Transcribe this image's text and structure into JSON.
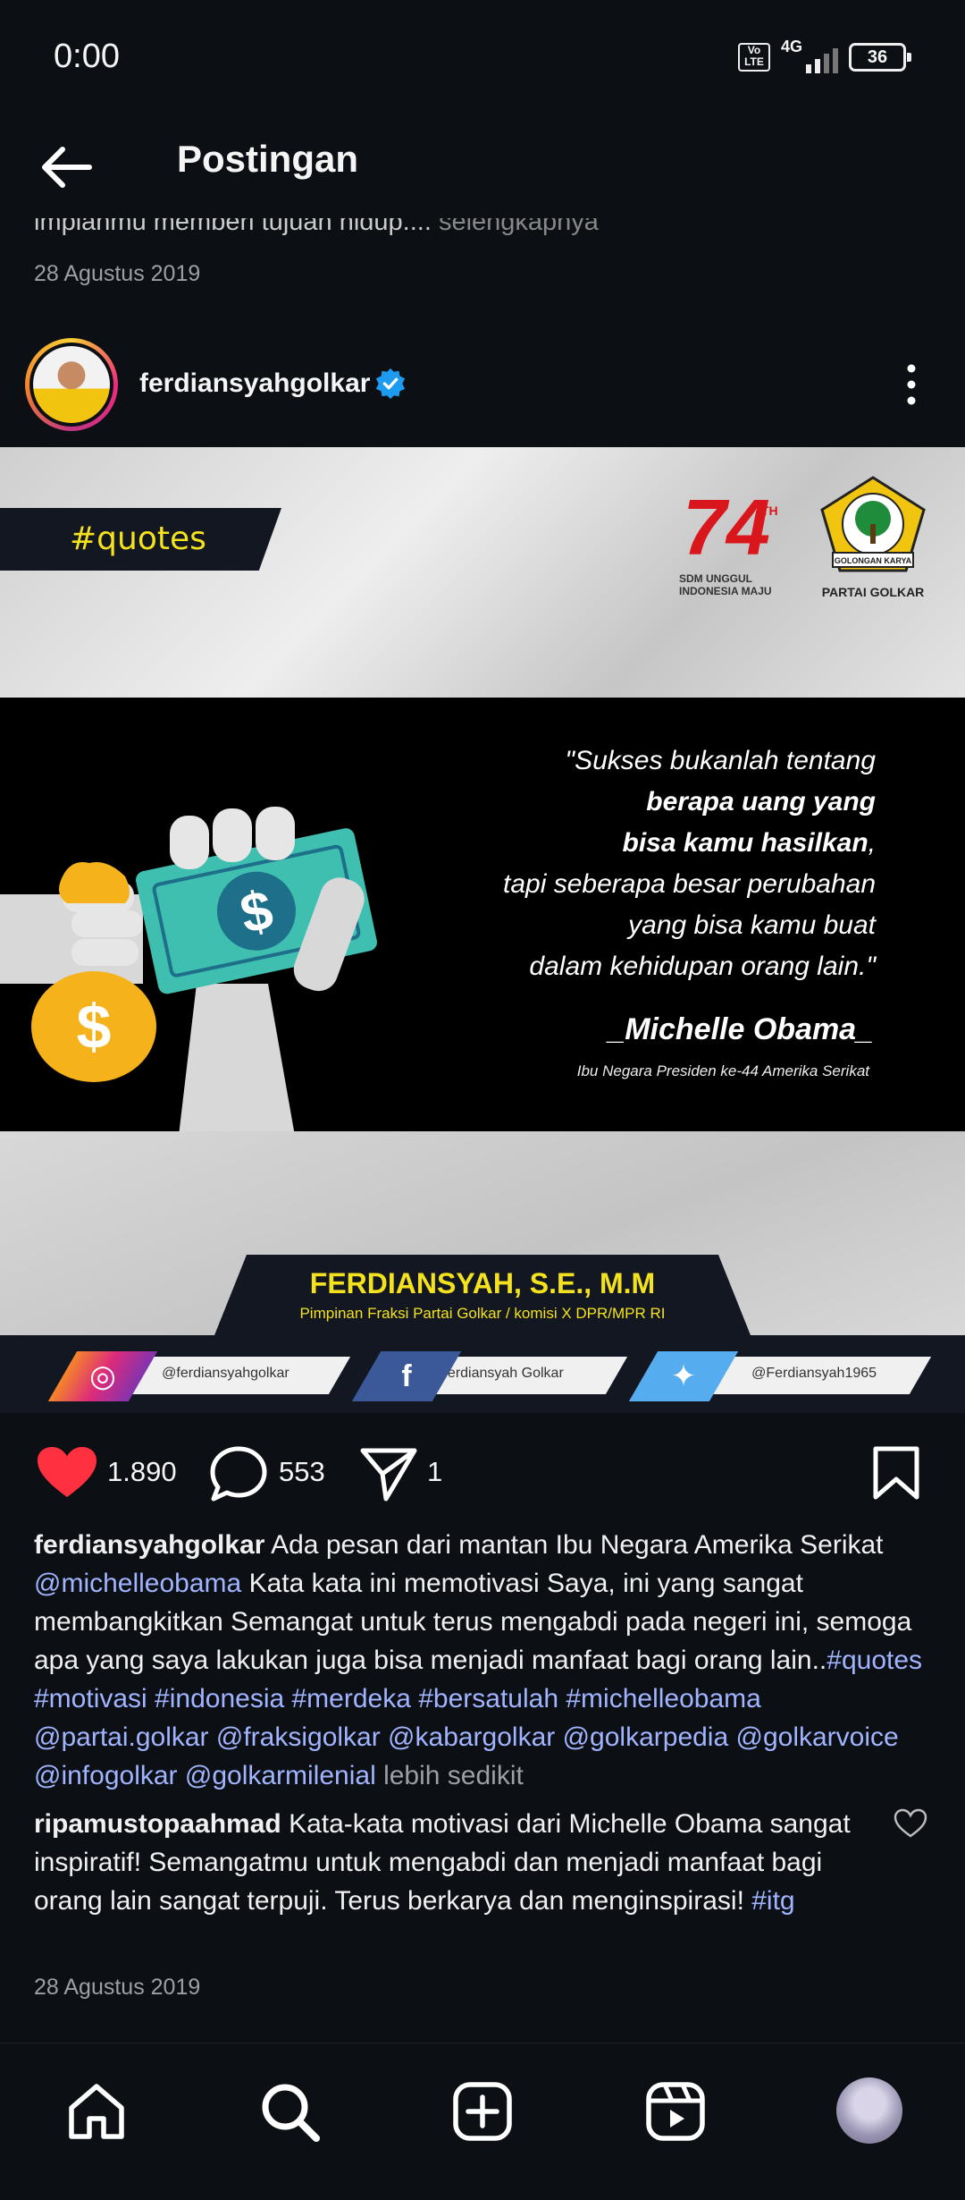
{
  "status_bar": {
    "time": "0:00",
    "volte": "Vo LTE",
    "network": "4G",
    "battery": "36"
  },
  "header": {
    "title": "Postingan",
    "back_icon": "arrow-left-icon"
  },
  "previous_post": {
    "caption_fragment": "impianmu memberi tujuan hidup....",
    "more_label": "selengkapnya",
    "date": "28 Agustus 2019"
  },
  "post": {
    "username": "ferdiansyahgolkar",
    "verified": true,
    "image": {
      "hashtag": "#quotes",
      "logo74_text": "SDM UNGGUL INDONESIA MAJU",
      "logo74_number": "74",
      "logo74_suffix": "TH",
      "golkar_banner": "GOLONGAN KARYA",
      "golkar_caption": "PARTAI GOLKAR",
      "quote_line1": "\"Sukses bukanlah tentang",
      "quote_line2": "berapa uang yang",
      "quote_line3": "bisa kamu hasilkan",
      "quote_line3_tail": ",",
      "quote_line4": "tapi seberapa besar perubahan",
      "quote_line5": "yang bisa kamu buat",
      "quote_line6": "dalam kehidupan orang lain.\"",
      "author": "_Michelle Obama_",
      "author_subtitle": "Ibu Negara Presiden ke-44 Amerika Serikat",
      "name": "FERDIANSYAH, S.E., M.M",
      "name_subtitle": "Pimpinan Fraksi Partai Golkar / komisi X DPR/MPR RI",
      "social_instagram": "@ferdiansyahgolkar",
      "social_facebook": "Ferdiansyah Golkar",
      "social_twitter": "@Ferdiansyah1965"
    },
    "likes": "1.890",
    "comments": "553",
    "shares": "1",
    "caption": {
      "username": "ferdiansyahgolkar",
      "text1": " Ada pesan dari mantan Ibu Negara Amerika Serikat ",
      "mention1": "@michelleobama",
      "text2": " Kata kata ini memotivasi Saya, ini yang sangat membangkitkan Semangat untuk terus mengabdi pada negeri ini, semoga apa yang saya lakukan juga bisa menjadi manfaat bagi orang lain..",
      "tags": "#quotes  #motivasi #indonesia #merdeka #bersatulah #michelleobama @partai.golkar @fraksigolkar @kabargolkar @golkarpedia @golkarvoice @infogolkar @golkarmilenial",
      "less_label": "lebih sedikit"
    },
    "comment": {
      "username": "ripamustopaahmad",
      "text": " Kata-kata motivasi dari Michelle Obama sangat inspiratif! Semangatmu untuk mengabdi dan menjadi manfaat bagi orang lain sangat terpuji. Terus berkarya dan menginspirasi! ",
      "tag": "#itg"
    },
    "date": "28 Agustus 2019"
  },
  "bottom_nav": [
    "home-icon",
    "search-icon",
    "create-icon",
    "reels-icon",
    "profile-avatar"
  ],
  "colors": {
    "background": "#0c0f14",
    "like_red": "#ff3040",
    "link_blue": "#a0b4ff",
    "verified_blue": "#1d9bf0",
    "accent_yellow": "#f4e21e"
  }
}
